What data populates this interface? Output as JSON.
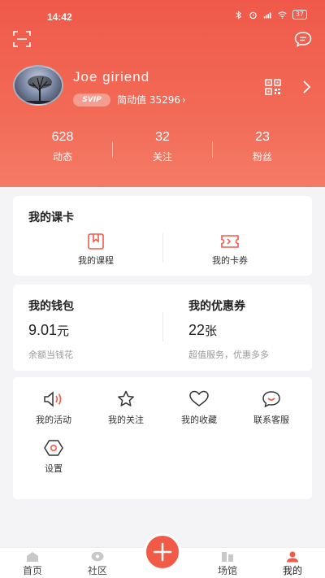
{
  "status": {
    "time": "14:42",
    "battery": "37"
  },
  "profile": {
    "name": "Joe giriend",
    "vip": "SVIP",
    "score": "简动值 35296",
    "score_chevron": "›"
  },
  "stats": [
    {
      "num": "628",
      "label": "动态"
    },
    {
      "num": "32",
      "label": "关注"
    },
    {
      "num": "23",
      "label": "粉丝"
    }
  ],
  "course_card": {
    "title": "我的课卡",
    "items": [
      {
        "label": "我的课程"
      },
      {
        "label": "我的卡券"
      }
    ]
  },
  "wallet": {
    "title": "我的钱包",
    "value": "9.01",
    "unit": "元",
    "sub": "余额当钱花"
  },
  "coupon": {
    "title": "我的优惠券",
    "value": "22",
    "unit": "张",
    "sub": "超值服务，优惠多多"
  },
  "services": [
    {
      "label": "我的活动",
      "icon": "speaker-icon"
    },
    {
      "label": "我的关注",
      "icon": "star-icon"
    },
    {
      "label": "我的收藏",
      "icon": "heart-icon"
    },
    {
      "label": "联系客服",
      "icon": "chat-smile-icon"
    },
    {
      "label": "设置",
      "icon": "settings-icon"
    }
  ],
  "tabs": [
    {
      "label": "首页",
      "icon": "home-icon"
    },
    {
      "label": "社区",
      "icon": "community-icon"
    },
    {
      "label": "场馆",
      "icon": "venue-icon"
    },
    {
      "label": "我的",
      "icon": "profile-icon"
    }
  ],
  "colors": {
    "accent": "#f25a48",
    "header_top": "#f0594a",
    "header_bottom": "#f47b66"
  }
}
